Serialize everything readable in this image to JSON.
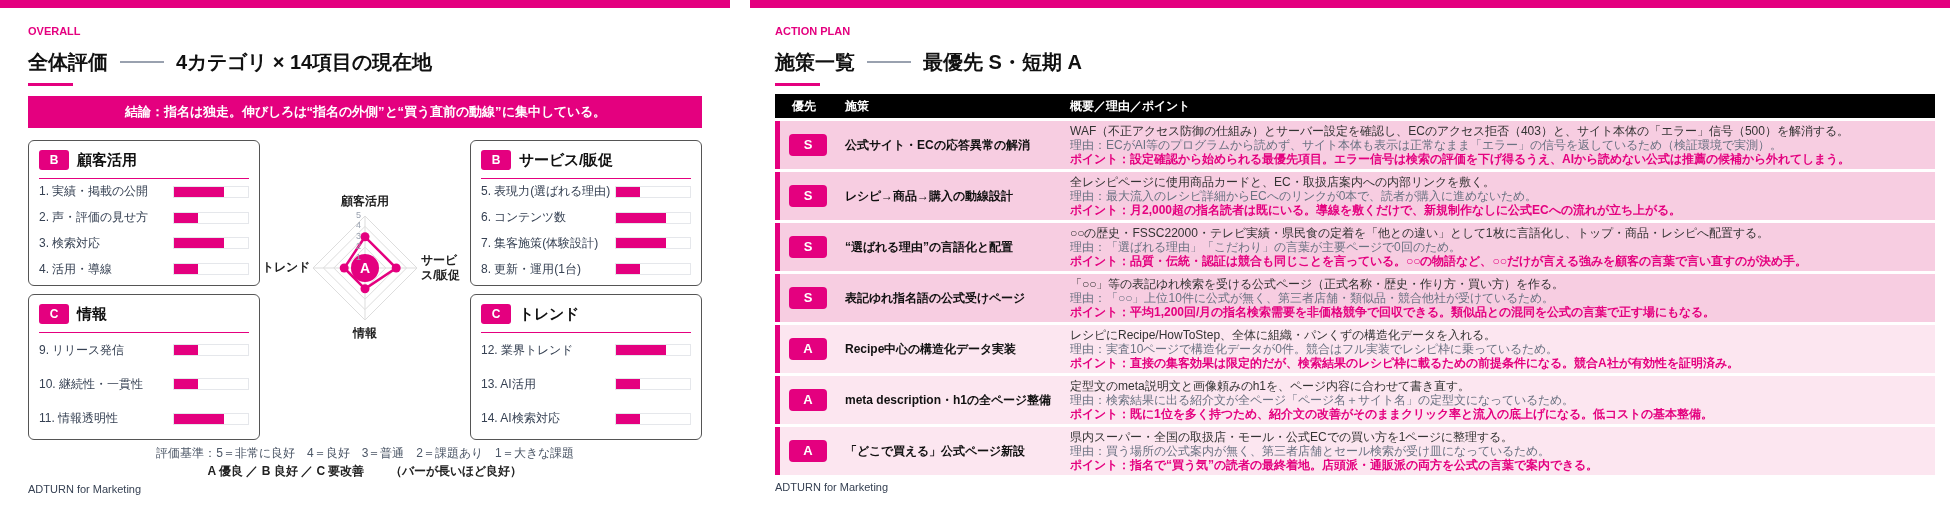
{
  "overall_slide": {
    "section_label": "OVERALL",
    "title": {
      "main": "全体評価",
      "sub": "4カテゴリ × 14項目の現在地"
    },
    "conclusion": "結論：指名は独走。伸びしろは“指名の外側”と“買う直前の動線”に集中している。",
    "categories": [
      {
        "grade": "B",
        "title": "顧客活用",
        "items": [
          {
            "label": "1. 実績・掲載の公開",
            "level": 0.67
          },
          {
            "label": "2. 声・評価の見せ方",
            "level": 0.33
          },
          {
            "label": "3. 検索対応",
            "level": 0.67
          },
          {
            "label": "4. 活用・導線",
            "level": 0.33
          }
        ]
      },
      {
        "grade": "B",
        "title": "サービス/販促",
        "items": [
          {
            "label": "5. 表現力(選ばれる理由)",
            "level": 0.33
          },
          {
            "label": "6. コンテンツ数",
            "level": 0.67
          },
          {
            "label": "7. 集客施策(体験設計)",
            "level": 0.67
          },
          {
            "label": "8. 更新・運用(1台)",
            "level": 0.33
          }
        ]
      },
      {
        "grade": "C",
        "title": "情報",
        "items": [
          {
            "label": "9. リリース発信",
            "level": 0.33
          },
          {
            "label": "10. 継続性・一貫性",
            "level": 0.33
          },
          {
            "label": "11. 情報透明性",
            "level": 0.67
          }
        ]
      },
      {
        "grade": "C",
        "title": "トレンド",
        "items": [
          {
            "label": "12. 業界トレンド",
            "level": 0.67
          },
          {
            "label": "13. AI活用",
            "level": 0.33
          },
          {
            "label": "14. AI検索対応",
            "level": 0.33
          }
        ]
      }
    ],
    "radar": {
      "overall_grade": "A",
      "chart_data": {
        "type": "radar",
        "categories": [
          "顧客活用",
          "サービス/販促",
          "情報",
          "トレンド"
        ],
        "values": [
          3,
          3,
          2,
          2
        ],
        "ylim": [
          0,
          5
        ],
        "yticks": [
          1,
          2,
          3,
          4,
          5
        ]
      }
    },
    "legend": {
      "scale": "評価基準：5＝非常に良好　4＝良好　3＝普通　2＝課題あり　1＝大きな課題",
      "grades": "A 優良 ／ B 良好 ／ C 要改善",
      "note": "（バーが長いほど良好）"
    },
    "footer": "ADTURN for Marketing"
  },
  "action_slide": {
    "section_label": "ACTION PLAN",
    "title": {
      "main": "施策一覧",
      "sub": "最優先 S・短期 A"
    },
    "table": {
      "columns": [
        "優先",
        "施策",
        "概要／理由／ポイント"
      ],
      "rows": [
        {
          "priority": "S",
          "highlighted": true,
          "measure": "公式サイト・ECの応答異常の解消",
          "summary": "WAF（不正アクセス防御の仕組み）とサーバー設定を確認し、ECのアクセス拒否（403）と、サイト本体の「エラー」信号（500）を解消する。",
          "reason": "理由：ECがAI等のプログラムから読めず、サイト本体も表示は正常なまま「エラー」の信号を返しているため（検証環境で実測）。",
          "point": "ポイント：設定確認から始められる最優先項目。エラー信号は検索の評価を下げ得るうえ、AIから読めない公式は推薦の候補から外れてしまう。"
        },
        {
          "priority": "S",
          "highlighted": true,
          "measure": "レシピ→商品→購入の動線設計",
          "summary": "全レシピページに使用商品カードと、EC・取扱店案内への内部リンクを敷く。",
          "reason": "理由：最大流入のレシピ詳細からECへのリンクが0本で、読者が購入に進めないため。",
          "point": "ポイント：月2,000超の指名読者は既にいる。導線を敷くだけで、新規制作なしに公式ECへの流れが立ち上がる。"
        },
        {
          "priority": "S",
          "highlighted": true,
          "measure": "“選ばれる理由”の言語化と配置",
          "summary": "○○の歴史・FSSC22000・テレビ実績・県民食の定着を「他との違い」として1枚に言語化し、トップ・商品・レシピへ配置する。",
          "reason": "理由：「選ばれる理由」「こだわり」の言葉が主要ページで0回のため。",
          "point": "ポイント：品質・伝統・認証は競合も同じことを言っている。○○の物語など、○○だけが言える強みを顧客の言葉で言い直すのが決め手。"
        },
        {
          "priority": "S",
          "highlighted": true,
          "measure": "表記ゆれ指名語の公式受けページ",
          "summary": "「○○」等の表記ゆれ検索を受ける公式ページ（正式名称・歴史・作り方・買い方）を作る。",
          "reason": "理由：「○○」上位10件に公式が無く、第三者店舗・類似品・競合他社が受けているため。",
          "point": "ポイント：平均1,200回/月の指名検索需要を非価格競争で回収できる。類似品との混同を公式の言葉で正す場にもなる。"
        },
        {
          "priority": "A",
          "highlighted": false,
          "measure": "Recipe中心の構造化データ実装",
          "summary": "レシピにRecipe/HowToStep、全体に組織・パンくずの構造化データを入れる。",
          "reason": "理由：実査10ページで構造化データが0件。競合はフル実装でレシピ枠に乗っているため。",
          "point": "ポイント：直接の集客効果は限定的だが、検索結果のレシピ枠に載るための前提条件になる。競合A社が有効性を証明済み。"
        },
        {
          "priority": "A",
          "highlighted": false,
          "measure": "meta description・h1の全ページ整備",
          "summary": "定型文のmeta説明文と画像頼みのh1を、ページ内容に合わせて書き直す。",
          "reason": "理由：検索結果に出る紹介文が全ページ「ページ名＋サイト名」の定型文になっているため。",
          "point": "ポイント：既に1位を多く持つため、紹介文の改善がそのままクリック率と流入の底上げになる。低コストの基本整備。"
        },
        {
          "priority": "A",
          "highlighted": false,
          "measure": "「どこで買える」公式ページ新設",
          "summary": "県内スーパー・全国の取扱店・モール・公式ECでの買い方を1ページに整理する。",
          "reason": "理由：買う場所の公式案内が無く、第三者店舗とセール検索が受け皿になっているため。",
          "point": "ポイント：指名で“買う気”の読者の最終着地。店頭派・通販派の両方を公式の言葉で案内できる。"
        }
      ]
    },
    "footer": "ADTURN for Marketing"
  }
}
